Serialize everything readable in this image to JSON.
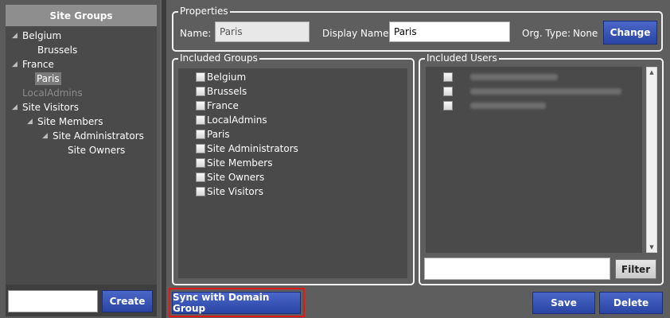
{
  "sidebar": {
    "title": "Site Groups",
    "tree": [
      {
        "label": "Belgium",
        "expanded": true,
        "state": "normal"
      },
      {
        "label": "Brussels",
        "state": "normal"
      },
      {
        "label": "France",
        "expanded": true,
        "state": "normal"
      },
      {
        "label": "Paris",
        "state": "selected"
      },
      {
        "label": "LocalAdmins",
        "state": "disabled"
      },
      {
        "label": "Site Visitors",
        "expanded": true,
        "state": "normal"
      },
      {
        "label": "Site Members",
        "expanded": true,
        "state": "normal"
      },
      {
        "label": "Site Administrators",
        "expanded": true,
        "state": "normal"
      },
      {
        "label": "Site Owners",
        "state": "normal"
      }
    ],
    "new_group_value": "",
    "create_label": "Create"
  },
  "properties": {
    "legend": "Properties",
    "name_label": "Name:",
    "name_value": "Paris",
    "display_name_label": "Display Name:",
    "display_name_value": "Paris",
    "org_type_label": "Org. Type:",
    "org_type_value": "None",
    "change_label": "Change"
  },
  "included_groups": {
    "legend": "Included Groups",
    "items": [
      {
        "label": "Belgium",
        "checked": false
      },
      {
        "label": "Brussels",
        "checked": false
      },
      {
        "label": "France",
        "checked": false
      },
      {
        "label": "LocalAdmins",
        "checked": false
      },
      {
        "label": "Paris",
        "checked": false
      },
      {
        "label": "Site Administrators",
        "checked": false
      },
      {
        "label": "Site Members",
        "checked": false
      },
      {
        "label": "Site Owners",
        "checked": false
      },
      {
        "label": "Site Visitors",
        "checked": false
      }
    ]
  },
  "included_users": {
    "legend": "Included Users",
    "user_count": 3,
    "filter_value": "",
    "filter_label": "Filter"
  },
  "actions": {
    "sync_label": "Sync with Domain Group",
    "save_label": "Save",
    "delete_label": "Delete"
  },
  "colors": {
    "accent_button": "#2f4cad",
    "highlight_border": "#e01818",
    "panel_bg": "#4a4a4a"
  }
}
